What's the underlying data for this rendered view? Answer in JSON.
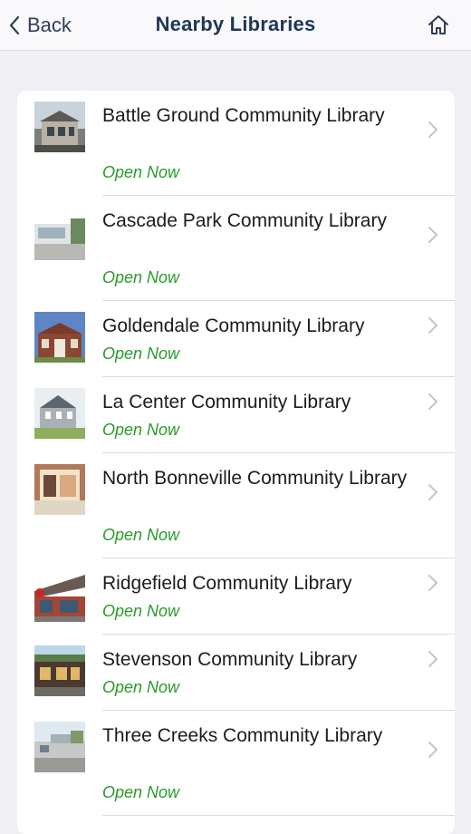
{
  "nav": {
    "back_label": "Back",
    "title": "Nearby Libraries"
  },
  "libraries": [
    {
      "name": "Battle Ground Community Library",
      "status": "Open Now",
      "thumb": "library-photo"
    },
    {
      "name": "Cascade Park Community Library",
      "status": "Open Now",
      "thumb": "library-photo"
    },
    {
      "name": "Goldendale Community Library",
      "status": "Open Now",
      "thumb": "library-photo"
    },
    {
      "name": "La Center Community Library",
      "status": "Open Now",
      "thumb": "library-photo"
    },
    {
      "name": "North Bonneville Community Library",
      "status": "Open Now",
      "thumb": "library-photo"
    },
    {
      "name": "Ridgefield Community Library",
      "status": "Open Now",
      "thumb": "library-photo"
    },
    {
      "name": "Stevenson Community Library",
      "status": "Open Now",
      "thumb": "library-photo"
    },
    {
      "name": "Three Creeks Community Library",
      "status": "Open Now",
      "thumb": "library-photo"
    }
  ],
  "colors": {
    "status_open": "#2a9a2a",
    "title": "#1f3656",
    "background": "#efeff4"
  }
}
